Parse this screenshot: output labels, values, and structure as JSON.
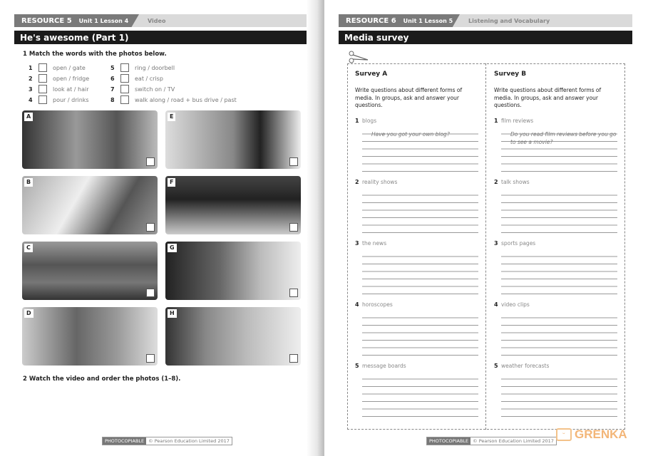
{
  "left": {
    "header": {
      "resource": "RESOURCE 5",
      "unit_lesson": "Unit 1  Lesson 4",
      "section": "Video"
    },
    "title": "He's awesome (Part 1)",
    "q1": "1  Match the words with the photos below.",
    "items": [
      {
        "n": "1",
        "text": "open / gate"
      },
      {
        "n": "2",
        "text": "open / fridge"
      },
      {
        "n": "3",
        "text": "look at / hair"
      },
      {
        "n": "4",
        "text": "pour / drinks"
      },
      {
        "n": "5",
        "text": "ring / doorbell"
      },
      {
        "n": "6",
        "text": "eat / crisp"
      },
      {
        "n": "7",
        "text": "switch on / TV"
      },
      {
        "n": "8",
        "text": "walk along / road + bus drive / past"
      }
    ],
    "photos": [
      "A",
      "E",
      "B",
      "F",
      "C",
      "G",
      "D",
      "H"
    ],
    "q2": "2  Watch the video and order the photos (1–8).",
    "footer": {
      "photocopiable": "PHOTOCOPIABLE",
      "copyright": "© Pearson Education Limited 2017"
    }
  },
  "right": {
    "header": {
      "resource": "RESOURCE 6",
      "unit_lesson": "Unit 1  Lesson 5",
      "section": "Listening and Vocabulary"
    },
    "title": "Media survey",
    "surveys": [
      {
        "title": "Survey A",
        "instruction": "Write questions about different forms of media. In groups, ask and answer your questions.",
        "items": [
          {
            "n": "1",
            "topic": "blogs",
            "example": "Have you got your own blog?"
          },
          {
            "n": "2",
            "topic": "reality shows"
          },
          {
            "n": "3",
            "topic": "the news"
          },
          {
            "n": "4",
            "topic": "horoscopes"
          },
          {
            "n": "5",
            "topic": "message boards"
          }
        ]
      },
      {
        "title": "Survey B",
        "instruction": "Write questions about different forms of media. In groups, ask and answer your questions.",
        "items": [
          {
            "n": "1",
            "topic": "film reviews",
            "example": "Do you read film reviews before you go to see a movie?"
          },
          {
            "n": "2",
            "topic": "talk shows"
          },
          {
            "n": "3",
            "topic": "sports pages"
          },
          {
            "n": "4",
            "topic": "video clips"
          },
          {
            "n": "5",
            "topic": "weather forecasts"
          }
        ]
      }
    ],
    "footer": {
      "photocopiable": "PHOTOCOPIABLE",
      "copyright": "© Pearson Education Limited 2017"
    }
  },
  "watermark": "GRENKA"
}
